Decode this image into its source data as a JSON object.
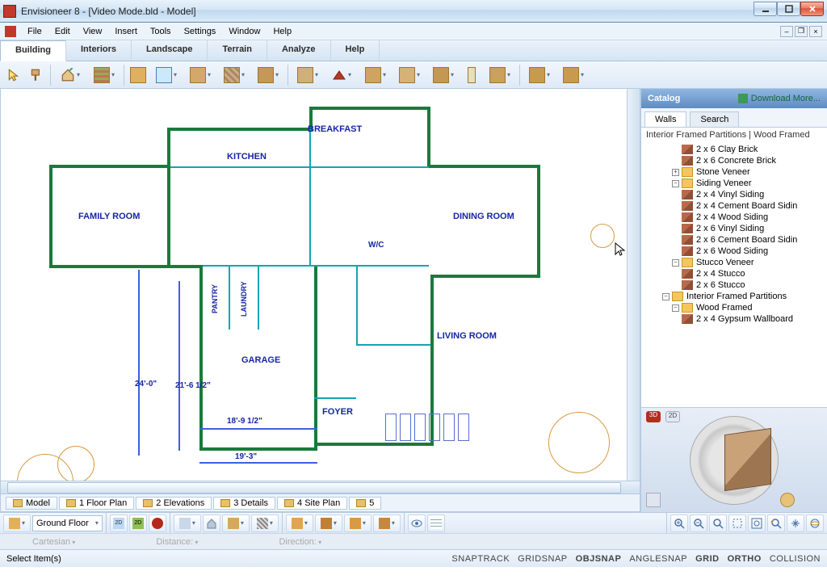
{
  "window": {
    "title": "Envisioneer 8 - [Video Mode.bld - Model]"
  },
  "menu": {
    "items": [
      "File",
      "Edit",
      "View",
      "Insert",
      "Tools",
      "Settings",
      "Window",
      "Help"
    ]
  },
  "ribbon": {
    "tabs": [
      "Building",
      "Interiors",
      "Landscape",
      "Terrain",
      "Analyze",
      "Help"
    ],
    "active": 0
  },
  "floorplan": {
    "rooms": {
      "breakfast": "BREAKFAST",
      "kitchen": "KITCHEN",
      "family_room": "FAMILY ROOM",
      "dining_room": "DINING ROOM",
      "pantry": "PANTRY",
      "laundry": "LAUNDRY",
      "wc": "W/C",
      "garage": "GARAGE",
      "foyer": "FOYER",
      "living_room": "LIVING ROOM"
    },
    "dims": {
      "a": "24'-0\"",
      "b": "21'-6 1/2\"",
      "c": "18'-9 1/2\"",
      "d": "19'-3\""
    }
  },
  "bottom_tabs": {
    "items": [
      "Model",
      "1 Floor Plan",
      "2 Elevations",
      "3 Details",
      "4 Site Plan",
      "5"
    ],
    "active": 0
  },
  "floor_selector": {
    "current": "Ground Floor"
  },
  "coord_row": {
    "mode": "Cartesian",
    "dist": "Distance:",
    "dir": "Direction:"
  },
  "status": {
    "left": "Select Item(s)",
    "right": [
      "SNAPTRACK",
      "GRIDSNAP",
      "OBJSNAP",
      "ANGLESNAP",
      "GRID",
      "ORTHO",
      "COLLISION"
    ]
  },
  "catalog": {
    "title": "Catalog",
    "download": "Download More...",
    "tabs": [
      "Walls",
      "Search"
    ],
    "active_tab": 0,
    "subtitle": "Interior Framed Partitions | Wood Framed",
    "tree": [
      {
        "depth": 4,
        "kind": "leaf",
        "label": "2 x 6 Clay Brick"
      },
      {
        "depth": 4,
        "kind": "leaf",
        "label": "2 x 6 Concrete Brick"
      },
      {
        "depth": 3,
        "kind": "folder",
        "exp": "+",
        "label": "Stone Veneer"
      },
      {
        "depth": 3,
        "kind": "folder",
        "exp": "-",
        "label": "Siding Veneer"
      },
      {
        "depth": 4,
        "kind": "leaf",
        "label": "2 x 4 Vinyl Siding"
      },
      {
        "depth": 4,
        "kind": "leaf",
        "label": "2 x 4 Cement Board Sidin"
      },
      {
        "depth": 4,
        "kind": "leaf",
        "label": "2 x 4 Wood Siding"
      },
      {
        "depth": 4,
        "kind": "leaf",
        "label": "2 x 6 Vinyl Siding"
      },
      {
        "depth": 4,
        "kind": "leaf",
        "label": "2 x 6 Cement Board Sidin"
      },
      {
        "depth": 4,
        "kind": "leaf",
        "label": "2 x 6 Wood Siding"
      },
      {
        "depth": 3,
        "kind": "folder",
        "exp": "-",
        "label": "Stucco Veneer"
      },
      {
        "depth": 4,
        "kind": "leaf",
        "label": "2 x 4 Stucco"
      },
      {
        "depth": 4,
        "kind": "leaf",
        "label": "2 x 6 Stucco"
      },
      {
        "depth": 2,
        "kind": "folder",
        "exp": "-",
        "label": "Interior Framed Partitions"
      },
      {
        "depth": 3,
        "kind": "folder",
        "exp": "-",
        "label": "Wood Framed"
      },
      {
        "depth": 4,
        "kind": "leaf",
        "label": "2 x 4 Gypsum Wallboard"
      }
    ]
  }
}
